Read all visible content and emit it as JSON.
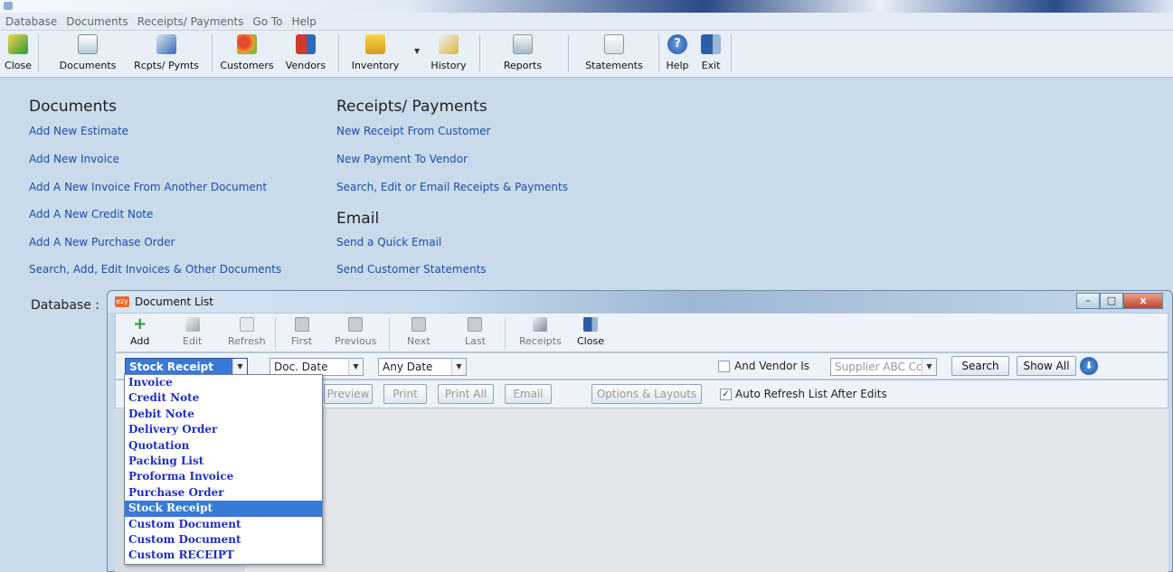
{
  "menu": [
    "Database",
    "Documents",
    "Receipts/ Payments",
    "Go To",
    "Help"
  ],
  "toolbar": {
    "close": "Close",
    "documents": "Documents",
    "rcpts": "Rcpts/ Pymts",
    "customers": "Customers",
    "vendors": "Vendors",
    "inventory": "Inventory",
    "history": "History",
    "reports": "Reports",
    "statements": "Statements",
    "help": "Help",
    "exit": "Exit"
  },
  "documents": {
    "title": "Documents",
    "links": [
      "Add New Estimate",
      "Add New Invoice",
      "Add A New Invoice From Another Document",
      "Add A New Credit Note",
      "Add A New Purchase Order",
      "Search, Add, Edit Invoices & Other Documents"
    ]
  },
  "receipts": {
    "title": "Receipts/ Payments",
    "links": [
      "New Receipt From Customer",
      "New Payment To Vendor",
      "Search, Edit or Email Receipts & Payments"
    ]
  },
  "email": {
    "title": "Email",
    "links": [
      "Send a Quick Email",
      "Send Customer Statements"
    ]
  },
  "database_label": "Database :",
  "doclist": {
    "title": "Document List",
    "toolbar": {
      "add": "Add",
      "edit": "Edit",
      "refresh": "Refresh",
      "first": "First",
      "previous": "Previous",
      "next": "Next",
      "last": "Last",
      "receipts": "Receipts",
      "close": "Close"
    },
    "filter": {
      "doc_type": "Stock Receipt",
      "date_field": "Doc. Date",
      "date_range": "Any Date",
      "vendor_check_label": "And Vendor Is",
      "vendor_value": "Supplier ABC Cc",
      "search": "Search",
      "show_all": "Show All"
    },
    "actions": {
      "preview": "Preview",
      "print": "Print",
      "print_all": "Print All",
      "email": "Email",
      "options": "Options & Layouts",
      "auto_refresh": "Auto Refresh List After Edits"
    },
    "dropdown_items": [
      "Invoice",
      "Credit Note",
      "Debit Note",
      "Delivery Order",
      "Quotation",
      "Packing List",
      "Proforma Invoice",
      "Purchase Order",
      "Stock Receipt",
      "Custom Document",
      "Custom Document",
      "Custom RECEIPT"
    ],
    "dropdown_selected": "Stock Receipt"
  },
  "colors": {
    "link": "#1d4fa8",
    "selection": "#3a7ad4",
    "dropdown_text": "#1f2fc4",
    "background": "#c9daea"
  }
}
